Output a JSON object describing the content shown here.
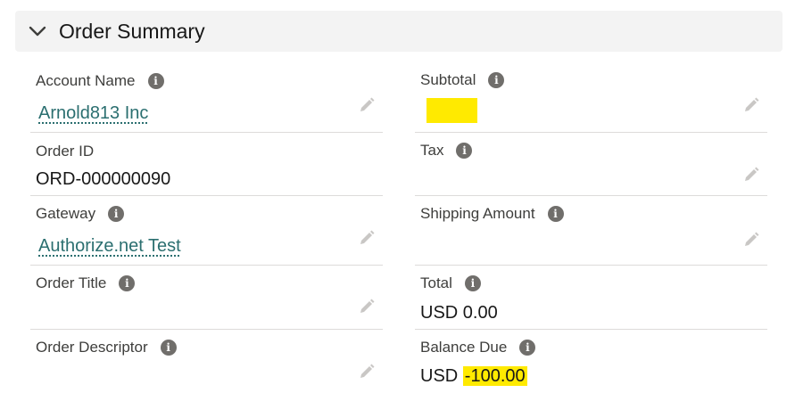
{
  "section": {
    "title": "Order Summary",
    "toggle_icon": "chevron-down-icon"
  },
  "left_fields": [
    {
      "label": "Account Name",
      "value": "Arnold813 Inc",
      "type": "link",
      "editable": true
    },
    {
      "label": "Order ID",
      "value": "ORD-000000090",
      "type": "text",
      "editable": false
    },
    {
      "label": "Gateway",
      "value": "Authorize.net Test",
      "type": "link",
      "editable": true
    },
    {
      "label": "Order Title",
      "value": "",
      "type": "text",
      "editable": true
    },
    {
      "label": "Order Descriptor",
      "value": "",
      "type": "text",
      "editable": true
    }
  ],
  "right_fields": [
    {
      "label": "Subtotal",
      "value": "",
      "type": "text",
      "editable": true,
      "highlighted": true
    },
    {
      "label": "Tax",
      "value": "",
      "type": "text",
      "editable": true
    },
    {
      "label": "Shipping Amount",
      "value": "",
      "type": "text",
      "editable": true
    },
    {
      "label": "Total",
      "value": "USD 0.00",
      "type": "text",
      "editable": false
    },
    {
      "label": "Balance Due",
      "currency": "USD",
      "amount": "-100.00",
      "type": "currency",
      "editable": false,
      "highlighted": true
    }
  ],
  "colors": {
    "highlight": "#ffea00",
    "link": "#2b6f70",
    "header_bg": "#f3f3f3"
  }
}
